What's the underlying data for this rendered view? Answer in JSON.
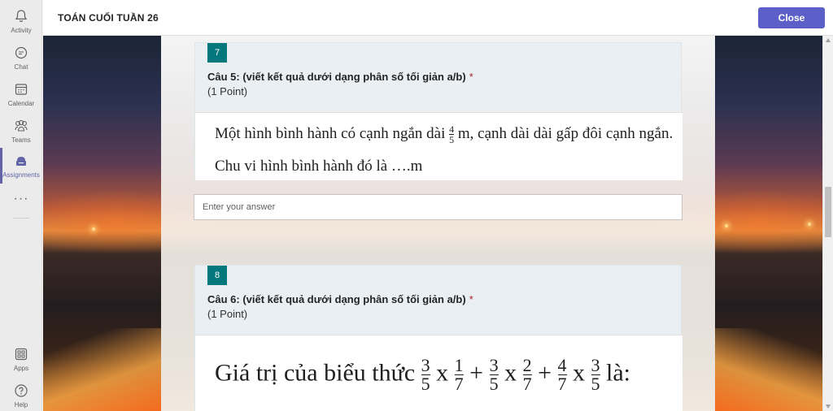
{
  "rail": {
    "items": [
      {
        "label": "Activity",
        "icon": "bell-icon"
      },
      {
        "label": "Chat",
        "icon": "chat-icon"
      },
      {
        "label": "Calendar",
        "icon": "calendar-icon"
      },
      {
        "label": "Teams",
        "icon": "teams-icon"
      },
      {
        "label": "Assignments",
        "icon": "assignments-icon",
        "active": true
      },
      {
        "label": "Apps",
        "icon": "apps-icon"
      },
      {
        "label": "Help",
        "icon": "help-icon"
      }
    ],
    "more": "···"
  },
  "header": {
    "title": "TOÁN CUỐI TUẦN 26",
    "close_label": "Close",
    "accent": "#5b5fc7"
  },
  "questions": [
    {
      "number": "7",
      "title": "Câu 5: (viết kết quả dưới dạng phân số tối giản a/b)",
      "required": "*",
      "points": "(1 Point)",
      "line1_before": "Một hình bình hành có cạnh ngắn dài",
      "frac_num": "4",
      "frac_den": "5",
      "line1_after": "m, cạnh dài dài gấp đôi cạnh ngắn.",
      "line2": "Chu vi hình bình hành đó là ….m",
      "answer_placeholder": "Enter your answer"
    },
    {
      "number": "8",
      "title": "Câu 6: (viết kết quả dưới dạng phân số tối giản a/b)",
      "required": "*",
      "points": "(1 Point)",
      "expr_prefix": "Giá trị của biểu thức",
      "f1n": "3",
      "f1d": "5",
      "op1": "x",
      "f2n": "1",
      "f2d": "7",
      "op2": "+",
      "f3n": "3",
      "f3d": "5",
      "op3": "x",
      "f4n": "2",
      "f4d": "7",
      "op4": "+",
      "f5n": "4",
      "f5d": "7",
      "op5": "x",
      "f6n": "3",
      "f6d": "5",
      "expr_suffix": "là:"
    }
  ],
  "colors": {
    "question_badge": "#03787c",
    "required": "#a4262c"
  }
}
